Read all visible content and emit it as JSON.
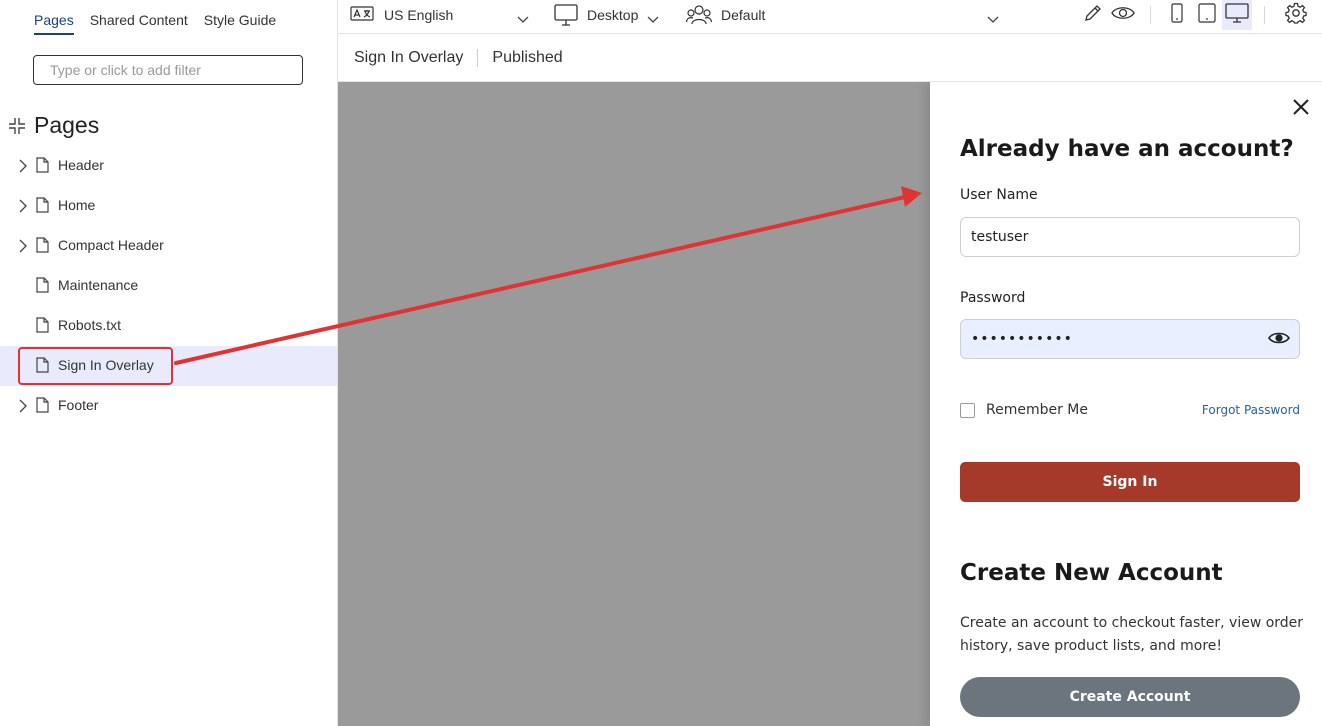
{
  "left_panel": {
    "tabs": [
      {
        "label": "Pages",
        "active": true
      },
      {
        "label": "Shared Content",
        "active": false
      },
      {
        "label": "Style Guide",
        "active": false
      }
    ],
    "filter_placeholder": "Type or click to add filter",
    "heading": "Pages",
    "tree": [
      {
        "label": "Header",
        "expandable": true,
        "selected": false
      },
      {
        "label": "Home",
        "expandable": true,
        "selected": false
      },
      {
        "label": "Compact Header",
        "expandable": true,
        "selected": false
      },
      {
        "label": "Maintenance",
        "expandable": false,
        "selected": false
      },
      {
        "label": "Robots.txt",
        "expandable": false,
        "selected": false
      },
      {
        "label": "Sign In Overlay",
        "expandable": false,
        "selected": true
      },
      {
        "label": "Footer",
        "expandable": true,
        "selected": false
      }
    ]
  },
  "toolbar": {
    "language": "US English",
    "device": "Desktop",
    "persona": "Default",
    "active_view": "desktop"
  },
  "breadcrumb": {
    "page": "Sign In Overlay",
    "status": "Published"
  },
  "overlay": {
    "title": "Already have an account?",
    "username_label": "User Name",
    "username_value": "testuser",
    "password_label": "Password",
    "password_value": "•••••••••••",
    "remember_label": "Remember Me",
    "forgot_label": "Forgot Password",
    "signin_label": "Sign In",
    "create_title": "Create New Account",
    "create_desc": "Create an account to checkout faster, view order history, save product lists, and more!",
    "create_label": "Create Account"
  },
  "colors": {
    "accent": "#1c3f8c",
    "selected_row": "#e9ebfc",
    "annotation": "#e03434",
    "signin_button": "#a63a2a",
    "create_button": "#6c757d",
    "canvas_gray": "#9a9a9a"
  }
}
